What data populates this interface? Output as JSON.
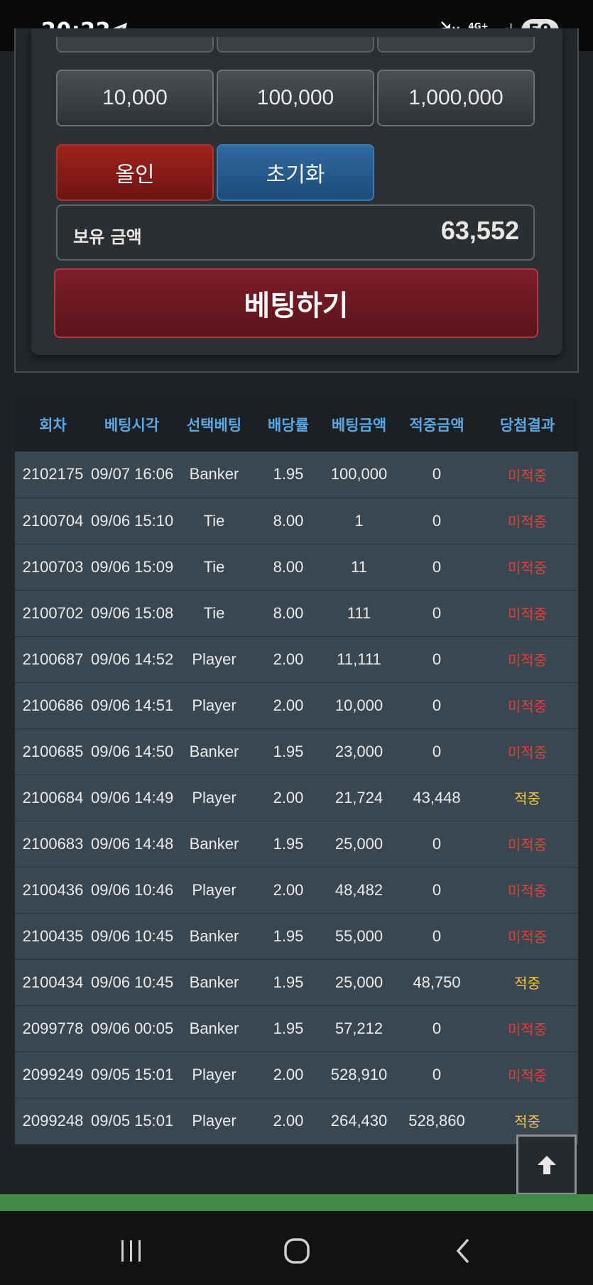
{
  "statusbar": {
    "time": "20:22",
    "network": "4G+",
    "battery": "59"
  },
  "amounts": [
    "10,000",
    "100,000",
    "1,000,000"
  ],
  "actions": {
    "allin_label": "올인",
    "reset_label": "초기화"
  },
  "balance": {
    "label": "보유 금액",
    "value": "63,552"
  },
  "bet_button_label": "베팅하기",
  "history": {
    "headers": [
      "회차",
      "베팅시각",
      "선택베팅",
      "배당률",
      "베팅금액",
      "적중금액",
      "당첨결과"
    ],
    "rows": [
      [
        "2102175",
        "09/07 16:06",
        "Banker",
        "1.95",
        "100,000",
        "0",
        "미적중"
      ],
      [
        "2100704",
        "09/06 15:10",
        "Tie",
        "8.00",
        "1",
        "0",
        "미적중"
      ],
      [
        "2100703",
        "09/06 15:09",
        "Tie",
        "8.00",
        "11",
        "0",
        "미적중"
      ],
      [
        "2100702",
        "09/06 15:08",
        "Tie",
        "8.00",
        "111",
        "0",
        "미적중"
      ],
      [
        "2100687",
        "09/06 14:52",
        "Player",
        "2.00",
        "11,111",
        "0",
        "미적중"
      ],
      [
        "2100686",
        "09/06 14:51",
        "Player",
        "2.00",
        "10,000",
        "0",
        "미적중"
      ],
      [
        "2100685",
        "09/06 14:50",
        "Banker",
        "1.95",
        "23,000",
        "0",
        "미적중"
      ],
      [
        "2100684",
        "09/06 14:49",
        "Player",
        "2.00",
        "21,724",
        "43,448",
        "적중"
      ],
      [
        "2100683",
        "09/06 14:48",
        "Banker",
        "1.95",
        "25,000",
        "0",
        "미적중"
      ],
      [
        "2100436",
        "09/06 10:46",
        "Player",
        "2.00",
        "48,482",
        "0",
        "미적중"
      ],
      [
        "2100435",
        "09/06 10:45",
        "Banker",
        "1.95",
        "55,000",
        "0",
        "미적중"
      ],
      [
        "2100434",
        "09/06 10:45",
        "Banker",
        "1.95",
        "25,000",
        "48,750",
        "적중"
      ],
      [
        "2099778",
        "09/06 00:05",
        "Banker",
        "1.95",
        "57,212",
        "0",
        "미적중"
      ],
      [
        "2099249",
        "09/05 15:01",
        "Player",
        "2.00",
        "528,910",
        "0",
        "미적중"
      ],
      [
        "2099248",
        "09/05 15:01",
        "Player",
        "2.00",
        "264,430",
        "528,860",
        "적중"
      ]
    ]
  },
  "colors": {
    "header_text": "#5aa9e6",
    "miss": "#e0413b",
    "hit": "#f0c34a"
  }
}
